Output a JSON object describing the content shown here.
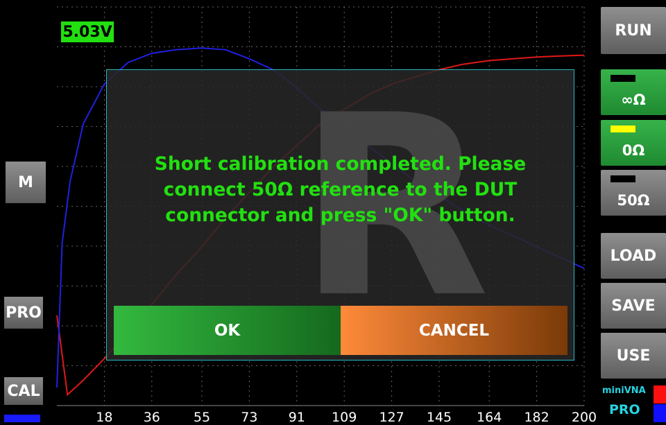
{
  "voltage_label": "5.03V",
  "watermark": "R",
  "dialog": {
    "message": "Short calibration completed. Please\nconnect 50Ω reference to the DUT\nconnector and press \"OK\" button.",
    "ok_label": "OK",
    "cancel_label": "CANCEL"
  },
  "left_buttons": {
    "m": "M",
    "pro": "PRO",
    "cal": "CAL"
  },
  "right_buttons": {
    "run": "RUN",
    "open": "∞Ω",
    "short": "0Ω",
    "load50": "50Ω",
    "load": "LOAD",
    "save": "SAVE",
    "use": "USE"
  },
  "logo": {
    "top": "miniVNA",
    "bottom": "PRO"
  },
  "x_ticks": [
    "18",
    "36",
    "55",
    "73",
    "91",
    "109",
    "127",
    "145",
    "164",
    "182",
    "200"
  ],
  "colors": {
    "voltage_bg": "#22e010",
    "message": "#22e010",
    "dialog_border": "#2ab7c0",
    "trace_red": "#e01818",
    "trace_blue": "#2020e0",
    "ok_button": "#33b93f",
    "cancel_button": "#ff8a3a",
    "active_indicator": "#ffff00"
  },
  "chart_data": {
    "type": "line",
    "x_ticks": [
      18,
      36,
      55,
      73,
      91,
      109,
      127,
      145,
      164,
      182,
      200
    ],
    "grid": true,
    "series": [
      {
        "color": "#e01818",
        "x": [
          0,
          4,
          10,
          18,
          28,
          36,
          45,
          55,
          64,
          73,
          82,
          91,
          100,
          109,
          118,
          127,
          136,
          145,
          154,
          164,
          173,
          182,
          191,
          200
        ],
        "y": [
          0.25,
          0.03,
          0.07,
          0.13,
          0.21,
          0.28,
          0.36,
          0.44,
          0.52,
          0.59,
          0.66,
          0.72,
          0.78,
          0.82,
          0.86,
          0.89,
          0.91,
          0.93,
          0.945,
          0.955,
          0.96,
          0.965,
          0.968,
          0.97
        ]
      },
      {
        "color": "#2020e0",
        "x": [
          0,
          2,
          5,
          10,
          18,
          27,
          36,
          45,
          55,
          64,
          73,
          82,
          91,
          100,
          109,
          118,
          127,
          136,
          145,
          154,
          164,
          173,
          182,
          191,
          200
        ],
        "y": [
          0.05,
          0.45,
          0.62,
          0.78,
          0.89,
          0.95,
          0.975,
          0.985,
          0.99,
          0.985,
          0.96,
          0.93,
          0.88,
          0.82,
          0.77,
          0.72,
          0.67,
          0.62,
          0.58,
          0.54,
          0.5,
          0.47,
          0.44,
          0.41,
          0.38
        ]
      }
    ]
  }
}
